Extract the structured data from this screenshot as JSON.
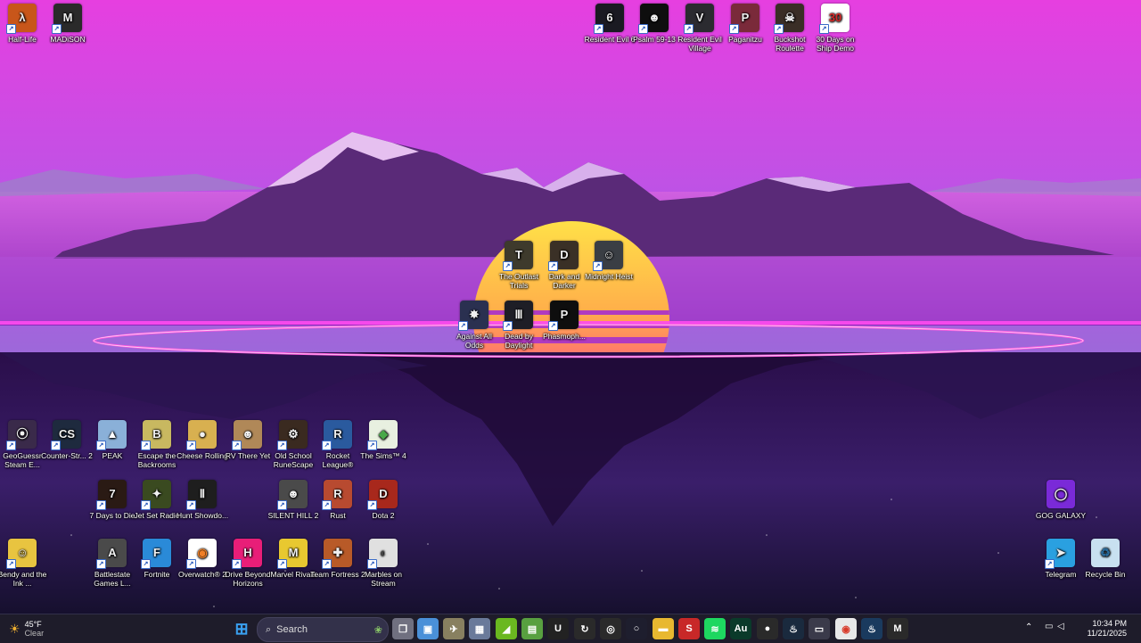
{
  "desktop_icons": [
    {
      "id": "half-life",
      "label": "Half-Life",
      "icon": "half-life-icon",
      "color": "#c8561a",
      "glyph": "λ"
    },
    {
      "id": "madison",
      "label": "MADiSON",
      "icon": "madison-icon",
      "color": "#2a2a2a",
      "glyph": "M"
    },
    {
      "id": "resident-evil-6",
      "label": "Resident Evil 6",
      "icon": "resident-evil-6-icon",
      "color": "#1a1a22",
      "glyph": "6"
    },
    {
      "id": "psalm",
      "label": "Psalm 59-13",
      "icon": "psalm-icon",
      "color": "#0e0e0e",
      "glyph": "☻"
    },
    {
      "id": "re-village",
      "label": "Resident Evil Village",
      "icon": "re-village-icon",
      "color": "#2b2b30",
      "glyph": "V"
    },
    {
      "id": "paganitzu",
      "label": "Paganitzu",
      "icon": "paganitzu-icon",
      "color": "#7a2a3a",
      "glyph": "P"
    },
    {
      "id": "buckshot",
      "label": "Buckshot Roulette",
      "icon": "buckshot-roulette-icon",
      "color": "#3a2e26",
      "glyph": "☠"
    },
    {
      "id": "30days",
      "label": "30 Days on Ship Demo",
      "icon": "30-days-icon",
      "color": "#ffffff",
      "glyph": "30"
    },
    {
      "id": "outlast",
      "label": "The Outlast Trials",
      "icon": "outlast-icon",
      "color": "#3e3a2c",
      "glyph": "T"
    },
    {
      "id": "dark-darker",
      "label": "Dark and Darker",
      "icon": "dark-and-darker-icon",
      "color": "#3a3026",
      "glyph": "D"
    },
    {
      "id": "midnight-heist",
      "label": "Midnight Heist",
      "icon": "midnight-heist-icon",
      "color": "#3a3e44",
      "glyph": "☺"
    },
    {
      "id": "against-odds",
      "label": "Against All Odds",
      "icon": "against-all-odds-icon",
      "color": "#2a3050",
      "glyph": "✸"
    },
    {
      "id": "dbd",
      "label": "Dead by Daylight",
      "icon": "dead-by-daylight-icon",
      "color": "#1e1e26",
      "glyph": "Ⅲ"
    },
    {
      "id": "phasmo",
      "label": "Phasmoph...",
      "icon": "phasmophobia-icon",
      "color": "#0e0e0e",
      "glyph": "P"
    },
    {
      "id": "geoguessr",
      "label": "GeoGuessr Steam E...",
      "icon": "geoguessr-icon",
      "color": "#3a2a4a",
      "glyph": "⦿"
    },
    {
      "id": "cs2",
      "label": "Counter-Str... 2",
      "icon": "counter-strike-icon",
      "color": "#1e2a3e",
      "glyph": "CS"
    },
    {
      "id": "peak",
      "label": "PEAK",
      "icon": "peak-icon",
      "color": "#8ab0d8",
      "glyph": "▲"
    },
    {
      "id": "backrooms",
      "label": "Escape the Backrooms",
      "icon": "backrooms-icon",
      "color": "#c8b860",
      "glyph": "B"
    },
    {
      "id": "cheese",
      "label": "Cheese Rolling",
      "icon": "cheese-rolling-icon",
      "color": "#d8b050",
      "glyph": "●"
    },
    {
      "id": "rv",
      "label": "RV There Yet",
      "icon": "rv-there-yet-icon",
      "color": "#b08858",
      "glyph": "☻"
    },
    {
      "id": "osrs",
      "label": "Old School RuneScape",
      "icon": "runescape-icon",
      "color": "#3a2a20",
      "glyph": "⚙"
    },
    {
      "id": "rocket",
      "label": "Rocket League®",
      "icon": "rocket-league-icon",
      "color": "#2a5a9e",
      "glyph": "R"
    },
    {
      "id": "sims",
      "label": "The Sims™ 4",
      "icon": "sims-icon",
      "color": "#e8f0e0",
      "glyph": "◆"
    },
    {
      "id": "7days",
      "label": "7 Days to Die",
      "icon": "7-days-icon",
      "color": "#2a1a14",
      "glyph": "7"
    },
    {
      "id": "jsr",
      "label": "Jet Set Radio",
      "icon": "jet-set-radio-icon",
      "color": "#3a4a20",
      "glyph": "✦"
    },
    {
      "id": "hunt",
      "label": "Hunt Showdo...",
      "icon": "hunt-showdown-icon",
      "color": "#1e1e1e",
      "glyph": "Ⅱ"
    },
    {
      "id": "silent-hill",
      "label": "SILENT HILL 2",
      "icon": "silent-hill-icon",
      "color": "#4a4a4a",
      "glyph": "☻"
    },
    {
      "id": "rust",
      "label": "Rust",
      "icon": "rust-icon",
      "color": "#b84a30",
      "glyph": "R"
    },
    {
      "id": "dota",
      "label": "Dota 2",
      "icon": "dota-icon",
      "color": "#a8281c",
      "glyph": "D"
    },
    {
      "id": "gog",
      "label": "GOG GALAXY",
      "icon": "gog-galaxy-icon",
      "color": "#7a2ad8",
      "glyph": "◯"
    },
    {
      "id": "bendy",
      "label": "Bendy and the Ink ...",
      "icon": "bendy-icon",
      "color": "#e8c440",
      "glyph": "☺"
    },
    {
      "id": "battlestate",
      "label": "Battlestate Games L...",
      "icon": "battlestate-icon",
      "color": "#4a4a4a",
      "glyph": "A"
    },
    {
      "id": "fortnite",
      "label": "Fortnite",
      "icon": "fortnite-icon",
      "color": "#2a8ad8",
      "glyph": "F"
    },
    {
      "id": "overwatch",
      "label": "Overwatch® 2",
      "icon": "overwatch-icon",
      "color": "#ffffff",
      "glyph": "◉"
    },
    {
      "id": "dbh",
      "label": "Drive Beyond Horizons",
      "icon": "drive-beyond-horizons-icon",
      "color": "#e81e78",
      "glyph": "H"
    },
    {
      "id": "rivals",
      "label": "Marvel Rivals",
      "icon": "marvel-rivals-icon",
      "color": "#e8c830",
      "glyph": "M"
    },
    {
      "id": "tf2",
      "label": "Team Fortress 2",
      "icon": "team-fortress-icon",
      "color": "#b85a28",
      "glyph": "✚"
    },
    {
      "id": "marbles",
      "label": "Marbles on Stream",
      "icon": "marbles-icon",
      "color": "#e0e0e0",
      "glyph": "◐"
    },
    {
      "id": "telegram",
      "label": "Telegram",
      "icon": "telegram-icon",
      "color": "#2aa0e0",
      "glyph": "➤"
    },
    {
      "id": "recycle",
      "label": "Recycle Bin",
      "icon": "recycle-bin-icon",
      "color": "#c8e0f0",
      "glyph": "♻"
    }
  ],
  "taskbar": {
    "weather": {
      "temp": "45°F",
      "condition": "Clear"
    },
    "search": {
      "label": "Search"
    },
    "apps": [
      {
        "id": "start",
        "icon": "windows-start-icon",
        "color": "#3aa0f0",
        "glyph": "⊞"
      },
      {
        "id": "task-view",
        "icon": "task-view-icon",
        "color": "#707080",
        "glyph": "❐"
      },
      {
        "id": "photos",
        "icon": "photos-icon",
        "color": "#4a90d8",
        "glyph": "▣"
      },
      {
        "id": "app3",
        "icon": "game-app-icon",
        "color": "#888060",
        "glyph": "✈"
      },
      {
        "id": "calculator",
        "icon": "calculator-icon",
        "color": "#6a7a9a",
        "glyph": "▦"
      },
      {
        "id": "nvidia",
        "icon": "nvidia-icon",
        "color": "#6ab820",
        "glyph": "◢"
      },
      {
        "id": "app6",
        "icon": "game-app-icon",
        "color": "#58a040",
        "glyph": "▤"
      },
      {
        "id": "epic",
        "icon": "epic-games-icon",
        "color": "#222222",
        "glyph": "U"
      },
      {
        "id": "app8",
        "icon": "arrow-app-icon",
        "color": "#2a2a2a",
        "glyph": "↻"
      },
      {
        "id": "app9",
        "icon": "circle-app-icon",
        "color": "#2a2a2a",
        "glyph": "◎"
      },
      {
        "id": "cortana",
        "icon": "cortana-icon",
        "color": "#1e1e2e",
        "glyph": "○"
      },
      {
        "id": "explorer",
        "icon": "file-explorer-icon",
        "color": "#e8b830",
        "glyph": "▬"
      },
      {
        "id": "app12",
        "icon": "red-app-icon",
        "color": "#c82828",
        "glyph": "S"
      },
      {
        "id": "spotify",
        "icon": "spotify-icon",
        "color": "#1ed760",
        "glyph": "≋"
      },
      {
        "id": "audition",
        "icon": "audition-icon",
        "color": "#0a3a2a",
        "glyph": "Au"
      },
      {
        "id": "obs",
        "icon": "obs-icon",
        "color": "#2a2a2a",
        "glyph": "●"
      },
      {
        "id": "steam1",
        "icon": "steam-icon",
        "color": "#1a2a3e",
        "glyph": "♨"
      },
      {
        "id": "app17",
        "icon": "controller-app-icon",
        "color": "#3a3a4a",
        "glyph": "▭"
      },
      {
        "id": "chrome",
        "icon": "chrome-icon",
        "color": "#e8e8e8",
        "glyph": "◉"
      },
      {
        "id": "steam2",
        "icon": "steam-icon",
        "color": "#1a3a5e",
        "glyph": "♨"
      },
      {
        "id": "app20",
        "icon": "app-icon",
        "color": "#2a2a2a",
        "glyph": "M"
      }
    ],
    "tray": {
      "time": "10:34 PM",
      "date": "11/21/2025"
    }
  }
}
